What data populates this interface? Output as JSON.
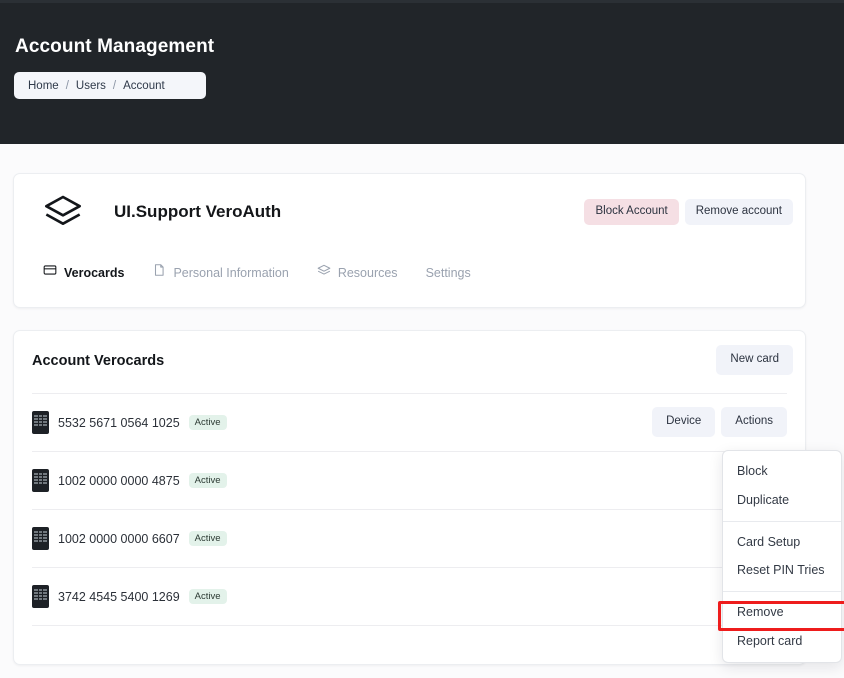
{
  "header": {
    "title": "Account Management",
    "breadcrumb": [
      "Home",
      "Users",
      "Account"
    ],
    "separator": "/"
  },
  "account": {
    "name": "UI.Support VeroAuth",
    "logo_icon": "layers-icon",
    "block_label": "Block Account",
    "remove_label": "Remove account",
    "tabs": [
      {
        "label": "Verocards",
        "icon": "card-icon",
        "active": true
      },
      {
        "label": "Personal Information",
        "icon": "document-icon",
        "active": false
      },
      {
        "label": "Resources",
        "icon": "layers-icon",
        "active": false
      },
      {
        "label": "Settings",
        "icon": "",
        "active": false
      }
    ]
  },
  "verocards": {
    "title": "Account Verocards",
    "new_card_label": "New card",
    "device_label": "Device",
    "actions_label": "Actions",
    "rows": [
      {
        "number": "5532 5671 0564 1025",
        "status": "Active"
      },
      {
        "number": "1002 0000 0000 4875",
        "status": "Active"
      },
      {
        "number": "1002 0000 0000 6607",
        "status": "Active"
      },
      {
        "number": "3742 4545 5400 1269",
        "status": "Active"
      }
    ]
  },
  "menu": {
    "groups": [
      [
        "Block",
        "Duplicate"
      ],
      [
        "Card Setup",
        "Reset PIN Tries"
      ],
      [
        "Remove",
        "Report card"
      ]
    ],
    "highlighted": "Report card"
  },
  "colors": {
    "header_bg": "#212529",
    "danger": "#f5dfe4",
    "badge_bg": "#e3f2ea",
    "highlight": "#ee1c1c",
    "button_bg": "#f1f3f9"
  }
}
